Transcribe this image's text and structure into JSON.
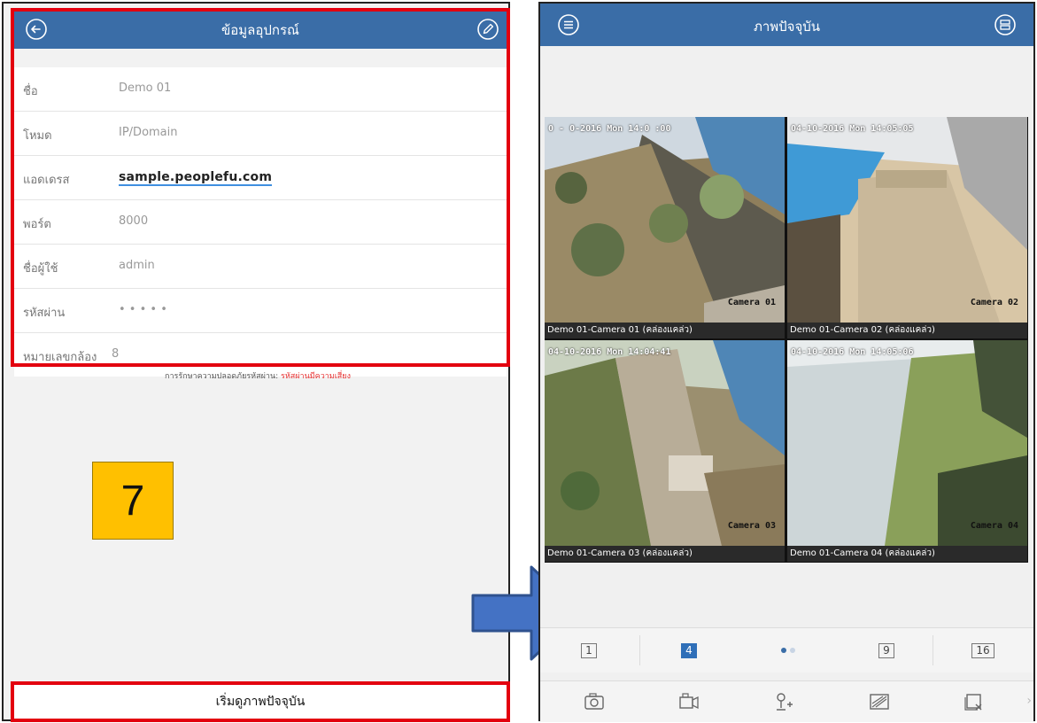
{
  "left_screen": {
    "header": {
      "title": "ข้อมูลอุปกรณ์",
      "back_icon": "back-arrow-icon",
      "edit_icon": "edit-pencil-icon"
    },
    "fields": [
      {
        "label": "ชื่อ",
        "value": "Demo 01"
      },
      {
        "label": "โหมด",
        "value": "IP/Domain"
      },
      {
        "label": "แอดเดรส",
        "value": "sample.peoplefu.com"
      },
      {
        "label": "พอร์ต",
        "value": "8000"
      },
      {
        "label": "ชื่อผู้ใช้",
        "value": "admin"
      },
      {
        "label": "รหัสผ่าน",
        "value": "• • • • •"
      },
      {
        "label": "หมายเลขกล้อง",
        "value": "8"
      }
    ],
    "password_hint": {
      "text": "การรักษาความปลอดภัยรหัสผ่าน:",
      "level": "รหัสผ่านมีความเสี่ยง"
    },
    "step_number": "7",
    "start_button": "เริ่มดูภาพปัจจุบัน",
    "highlight_color": "#e3000f"
  },
  "right_screen": {
    "header": {
      "title": "ภาพปัจจุบัน",
      "menu_icon": "menu-icon",
      "device_icon": "device-list-icon"
    },
    "cameras": [
      {
        "timestamp": "0 - 0-2016 Mon 14:0 :00",
        "overlay": "Camera 01",
        "caption": "Demo 01-Camera 01 (คล่องแคล่ว)"
      },
      {
        "timestamp": "04-10-2016 Mon 14:05:05",
        "overlay": "Camera 02",
        "caption": "Demo 01-Camera 02 (คล่องแคล่ว)"
      },
      {
        "timestamp": "04-10-2016 Mon 14:04:41",
        "overlay": "Camera 03",
        "caption": "Demo 01-Camera 03 (คล่องแคล่ว)"
      },
      {
        "timestamp": "04-10-2016 Mon 14:05:06",
        "overlay": "Camera 04",
        "caption": "Demo 01-Camera 04 (คล่องแคล่ว)"
      }
    ],
    "split_options": [
      "1",
      "4",
      "9",
      "16"
    ],
    "active_split": "4",
    "page_dots": 2,
    "toolbar_icons": [
      "capture-icon",
      "record-icon",
      "ptz-icon",
      "image-quality-icon",
      "close-all-icon"
    ],
    "accent_color": "#3a6da7"
  }
}
